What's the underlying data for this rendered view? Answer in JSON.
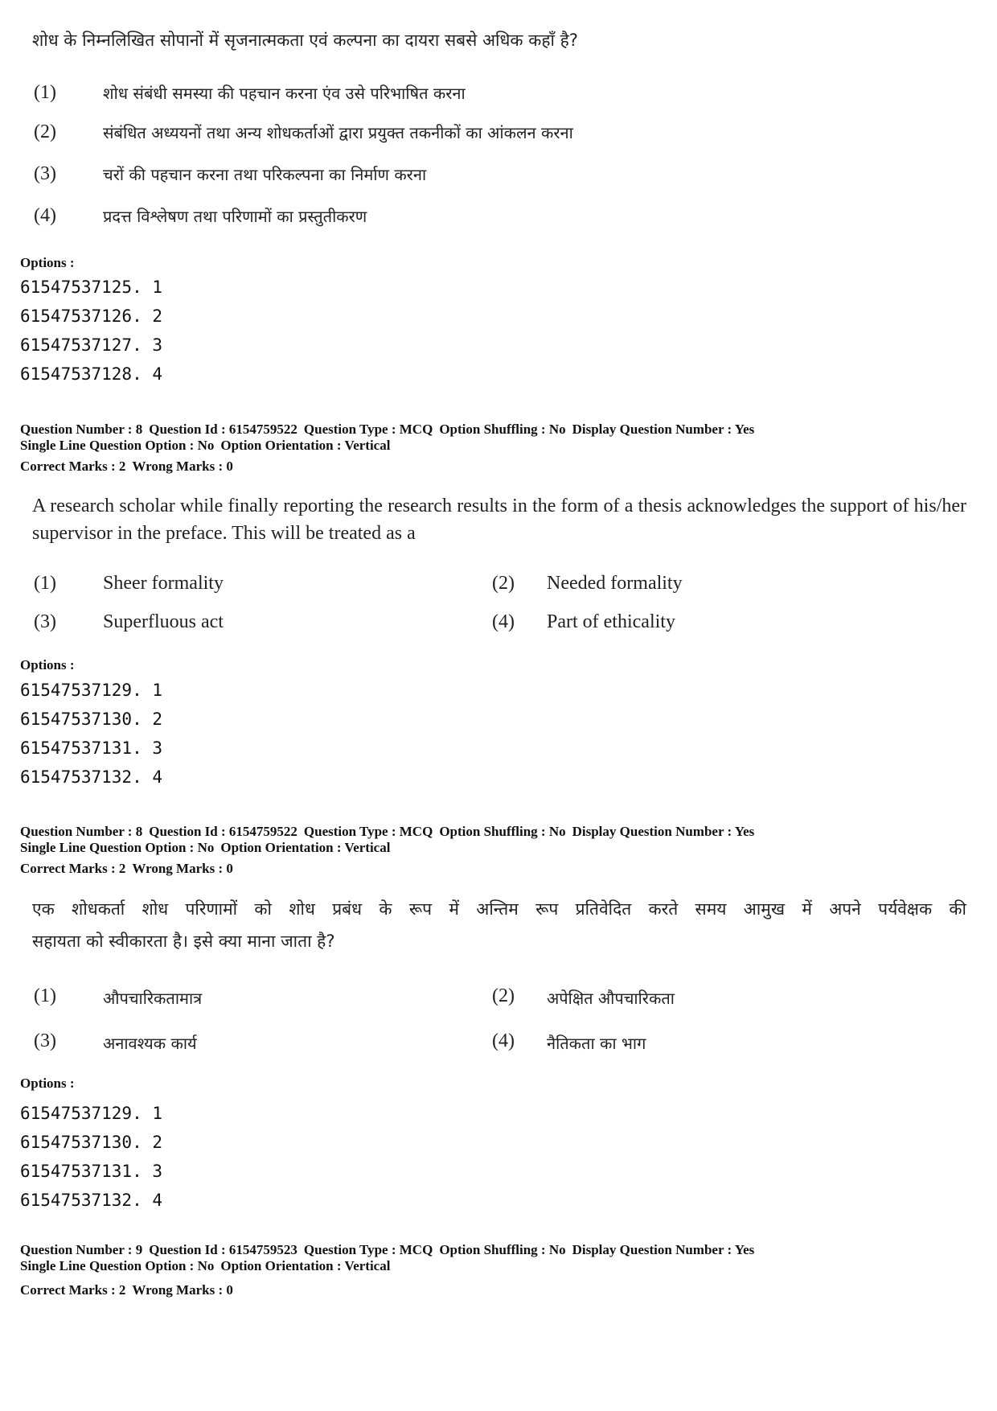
{
  "block_q7_tail": {
    "question_text": "शोध के निम्नलिखित सोपानों में सृजनात्मकता एवं कल्पना का दायरा सबसे अधिक कहाँ है?",
    "items": [
      {
        "num": "(1)",
        "text": "शोध संबंधी समस्या की पहचान करना एंव उसे परिभाषित करना"
      },
      {
        "num": "(2)",
        "text": "संबंधित अध्ययनों तथा अन्य शोधकर्ताओं द्वारा प्रयुक्त तकनीकों का आंकलन करना"
      },
      {
        "num": "(3)",
        "text": "चरों की पहचान करना तथा परिकल्पना का निर्माण करना"
      },
      {
        "num": "(4)",
        "text": "प्रदत्त विश्लेषण तथा परिणामों का प्रस्तुतीकरण"
      }
    ],
    "options_label": "Options :",
    "options": [
      "61547537125. 1",
      "61547537126. 2",
      "61547537127. 3",
      "61547537128. 4"
    ]
  },
  "block_q8_en": {
    "meta_line1": [
      "Question Number : 8",
      "Question Id : 6154759522",
      "Question Type : MCQ",
      "Option Shuffling : No",
      "Display Question Number : Yes"
    ],
    "meta_line2": [
      "Single Line Question Option : No",
      "Option Orientation : Vertical"
    ],
    "marks": [
      "Correct Marks : 2",
      "Wrong Marks : 0"
    ],
    "question_text": "A research scholar while finally reporting the research results in the form of a thesis acknowledges the support of his/her supervisor in the preface. This will be treated as a",
    "items": [
      {
        "num": "(1)",
        "text": "Sheer formality"
      },
      {
        "num": "(2)",
        "text": "Needed formality"
      },
      {
        "num": "(3)",
        "text": "Superfluous act"
      },
      {
        "num": "(4)",
        "text": "Part of ethicality"
      }
    ],
    "options_label": "Options :",
    "options": [
      "61547537129. 1",
      "61547537130. 2",
      "61547537131. 3",
      "61547537132. 4"
    ]
  },
  "block_q8_hi": {
    "meta_line1": [
      "Question Number : 8",
      "Question Id : 6154759522",
      "Question Type : MCQ",
      "Option Shuffling : No",
      "Display Question Number : Yes"
    ],
    "meta_line2": [
      "Single Line Question Option : No",
      "Option Orientation : Vertical"
    ],
    "marks": [
      "Correct Marks : 2",
      "Wrong Marks : 0"
    ],
    "question_line1": "एक शोधकर्ता शोध परिणामों को शोध प्रबंध के रूप में अन्तिम रूप प्रतिवेदित करते समय आमुख में अपने पर्यवेक्षक की",
    "question_line2": "सहायता को स्वीकारता है। इसे क्या माना जाता है?",
    "items": [
      {
        "num": "(1)",
        "text": "औपचारिकतामात्र"
      },
      {
        "num": "(2)",
        "text": "अपेक्षित औपचारिकता"
      },
      {
        "num": "(3)",
        "text": "अनावश्यक कार्य"
      },
      {
        "num": "(4)",
        "text": "नैतिकता का भाग"
      }
    ],
    "options_label": "Options :",
    "options": [
      "61547537129. 1",
      "61547537130. 2",
      "61547537131. 3",
      "61547537132. 4"
    ]
  },
  "block_q9": {
    "meta_line1": [
      "Question Number : 9",
      "Question Id : 6154759523",
      "Question Type : MCQ",
      "Option Shuffling : No",
      "Display Question Number : Yes"
    ],
    "meta_line2": [
      "Single Line Question Option : No",
      "Option Orientation : Vertical"
    ],
    "marks": [
      "Correct Marks : 2",
      "Wrong Marks : 0"
    ]
  }
}
